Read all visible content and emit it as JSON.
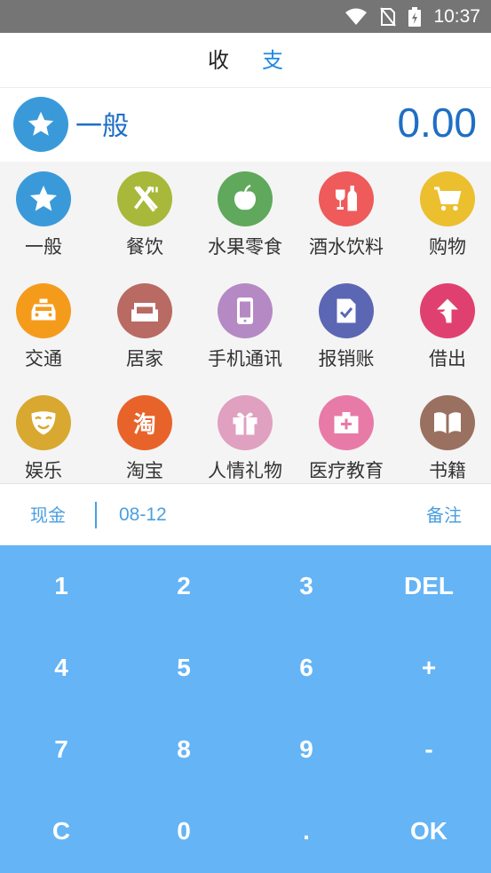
{
  "status_bar": {
    "time": "10:37"
  },
  "tabs": {
    "income": "收",
    "expense": "支"
  },
  "summary": {
    "category": "一般",
    "amount": "0.00"
  },
  "categories": [
    {
      "label": "一般",
      "icon": "star-icon",
      "color": "#3a9ad9"
    },
    {
      "label": "餐饮",
      "icon": "fork-knife-icon",
      "color": "#a8b83a"
    },
    {
      "label": "水果零食",
      "icon": "apple-icon",
      "color": "#5fa85c"
    },
    {
      "label": "酒水饮料",
      "icon": "wine-bottle-icon",
      "color": "#ef5a5a"
    },
    {
      "label": "购物",
      "icon": "cart-icon",
      "color": "#ecbf2f"
    },
    {
      "label": "交通",
      "icon": "taxi-icon",
      "color": "#f59b1c"
    },
    {
      "label": "居家",
      "icon": "sofa-icon",
      "color": "#b86a63"
    },
    {
      "label": "手机通讯",
      "icon": "phone-icon",
      "color": "#b58ac4"
    },
    {
      "label": "报销账",
      "icon": "document-check-icon",
      "color": "#5b67b3"
    },
    {
      "label": "借出",
      "icon": "arrow-up-icon",
      "color": "#e04070"
    },
    {
      "label": "娱乐",
      "icon": "mask-icon",
      "color": "#d8a830"
    },
    {
      "label": "淘宝",
      "icon": "taobao-icon",
      "color": "#e8632a"
    },
    {
      "label": "人情礼物",
      "icon": "gift-icon",
      "color": "#e0a0c0"
    },
    {
      "label": "医疗教育",
      "icon": "medkit-icon",
      "color": "#e87aa8"
    },
    {
      "label": "书籍",
      "icon": "book-icon",
      "color": "#9a7060"
    }
  ],
  "info": {
    "account": "现金",
    "date": "08-12",
    "note": "备注"
  },
  "keypad": [
    "1",
    "2",
    "3",
    "DEL",
    "4",
    "5",
    "6",
    "+",
    "7",
    "8",
    "9",
    "-",
    "C",
    "0",
    ".",
    "OK"
  ]
}
